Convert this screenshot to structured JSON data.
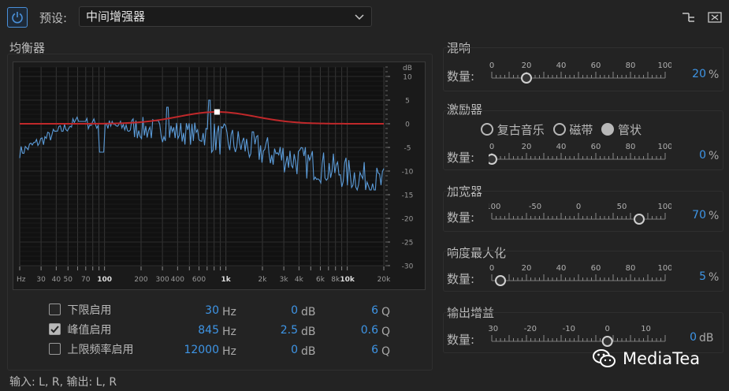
{
  "header": {
    "preset_label": "预设:",
    "preset_value": "中间增强器"
  },
  "eq": {
    "title": "均衡器",
    "db_unit": "dB",
    "db_ticks": [
      "10",
      "5",
      "0",
      "-5",
      "-10",
      "-15",
      "-20",
      "-25",
      "-30"
    ],
    "freq_ticks": [
      "Hz",
      "30",
      "40",
      "50",
      "70",
      "100",
      "200",
      "300",
      "400",
      "600",
      "1k",
      "2k",
      "3k",
      "4k",
      "6k",
      "8k",
      "10k",
      "20k"
    ],
    "rows": [
      {
        "label": "下限启用",
        "checked": false,
        "hz": "30",
        "db": "0",
        "q": "6"
      },
      {
        "label": "峰值启用",
        "checked": true,
        "hz": "845",
        "db": "2.5",
        "q": "0.6"
      },
      {
        "label": "上限频率启用",
        "checked": false,
        "hz": "12000",
        "db": "0",
        "q": "6"
      }
    ],
    "unit_hz": "Hz",
    "unit_db": "dB",
    "unit_q": "Q"
  },
  "reverb": {
    "title": "混响",
    "amount_label": "数量:",
    "scale": [
      "0",
      "20",
      "40",
      "60",
      "80",
      "100"
    ],
    "value": "20",
    "unit": "%",
    "level": 20
  },
  "exciter": {
    "title": "激励器",
    "modes": [
      {
        "label": "复古音乐",
        "selected": false
      },
      {
        "label": "磁带",
        "selected": false
      },
      {
        "label": "管状",
        "selected": true
      }
    ],
    "amount_label": "数量:",
    "scale": [
      "0",
      "20",
      "40",
      "60",
      "80",
      "100"
    ],
    "value": "0",
    "unit": "%",
    "level": 0
  },
  "widener": {
    "title": "加宽器",
    "amount_label": "数量:",
    "scale": [
      "-100",
      "-50",
      "0",
      "50",
      "100"
    ],
    "value": "70",
    "unit": "%",
    "level": 70
  },
  "loudness": {
    "title": "响度最大化",
    "amount_label": "数量:",
    "scale": [
      "0",
      "20",
      "40",
      "60",
      "80",
      "100"
    ],
    "value": "5",
    "unit": "%",
    "level": 5
  },
  "output_gain": {
    "title": "输出增益",
    "amount_label": "数量:",
    "scale": [
      "-30",
      "-20",
      "-10",
      "0",
      "10"
    ],
    "value": "0",
    "unit": "dB",
    "level": 0
  },
  "footer": {
    "io_text": "输入: L, R, 输出: L, R"
  },
  "watermark": {
    "text": "MediaTea"
  },
  "colors": {
    "accent": "#3e95e6",
    "eq_curve": "#c0282a",
    "spectrum": "#5b9bd8",
    "grid": "#3a3a3a"
  }
}
